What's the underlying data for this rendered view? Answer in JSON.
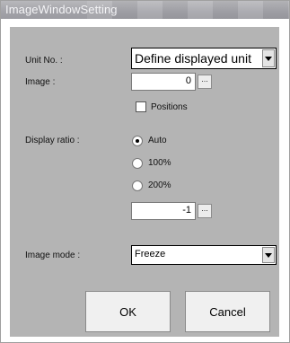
{
  "window": {
    "title": "ImageWindowSetting"
  },
  "unit": {
    "label": "Unit No. :",
    "value": "Define displayed unit"
  },
  "image": {
    "label": "Image :",
    "value": "0",
    "browse": "..."
  },
  "positions": {
    "label": "Positions",
    "checked": false
  },
  "display_ratio": {
    "label": "Display ratio :",
    "options": [
      "Auto",
      "100%",
      "200%"
    ],
    "selected": "Auto",
    "custom_value": "-1",
    "browse": "..."
  },
  "image_mode": {
    "label": "Image mode :",
    "value": "Freeze"
  },
  "buttons": {
    "ok": "OK",
    "cancel": "Cancel"
  }
}
